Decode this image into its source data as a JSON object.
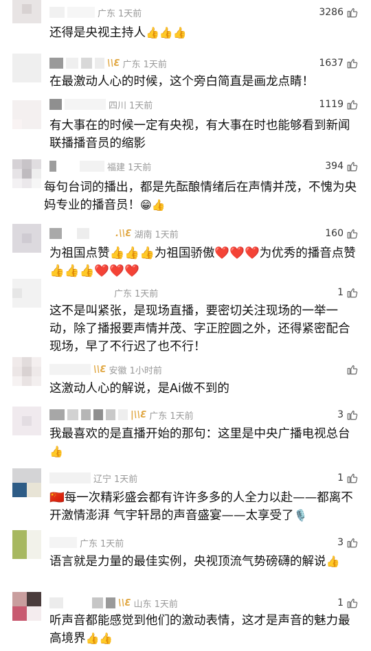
{
  "comments": [
    {
      "loc": "广东",
      "time": "1天前",
      "likes": "3286",
      "text": "还得是央视主持人",
      "emoji_tail": "👍👍👍"
    },
    {
      "loc": "广东",
      "time": "1天前",
      "likes": "1637",
      "text": "在最激动人心的时候，这个旁白简直是画龙点睛！",
      "emoji_tail": ""
    },
    {
      "loc": "四川",
      "time": "1天前",
      "likes": "1119",
      "text": "有大事在的时候一定有央视，有大事在时也能够看到新闻联播播音员的缩影",
      "emoji_tail": ""
    },
    {
      "loc": "福建",
      "time": "1天前",
      "likes": "394",
      "text": "每句台词的播出，都是先酝酿情绪后在声情并茂，不愧为央妈专业的播音员！",
      "emoji_tail": "😁👍"
    },
    {
      "loc": "湖南",
      "time": "1天前",
      "likes": "160",
      "text": "为祖国点赞👍👍👍为祖国骄傲❤️❤️❤️为优秀的播音点赞👍👍👍❤️❤️❤️",
      "emoji_tail": ""
    },
    {
      "loc": "广东",
      "time": "1天前",
      "likes": "1",
      "text": "这不是叫紧张，是现场直播，要密切关注现场的一举一动，除了播报要声情并茂、字正腔圆之外，还得紧密配合现场，早了不行迟了也不行！",
      "emoji_tail": ""
    },
    {
      "loc": "安徽",
      "time": "1小时前",
      "likes": "",
      "text": "这激动人心的解说，是Ai做不到的",
      "emoji_tail": ""
    },
    {
      "loc": "广东",
      "time": "1天前",
      "likes": "3",
      "text": "我最喜欢的是直播开始的那句：这里是中央广播电视总台",
      "emoji_tail": "👍"
    },
    {
      "loc": "辽宁",
      "time": "1天前",
      "likes": "1",
      "text": "🇨🇳每一次精彩盛会都有许许多多的人全力以赴——都离不开激情澎湃 气宇轩昂的声音盛宴——太享受了",
      "emoji_tail": "🎙️"
    },
    {
      "loc": "广东",
      "time": "1天前",
      "likes": "3",
      "text": "语言就是力量的最佳实例，央视顶流气势磅礴的解说",
      "emoji_tail": "👍"
    },
    {
      "loc": "山东",
      "time": "1天前",
      "likes": "1",
      "text": "听声音都能感觉到他们的激动表情，这才是声音的魅力最高境界",
      "emoji_tail": "👍👍"
    }
  ],
  "colors": {
    "meta": "#999999",
    "vip": "#e0a640",
    "text": "#111111"
  },
  "icons": {
    "like": "thumbs-up-outline-icon",
    "verified": "vip-badge-icon"
  }
}
